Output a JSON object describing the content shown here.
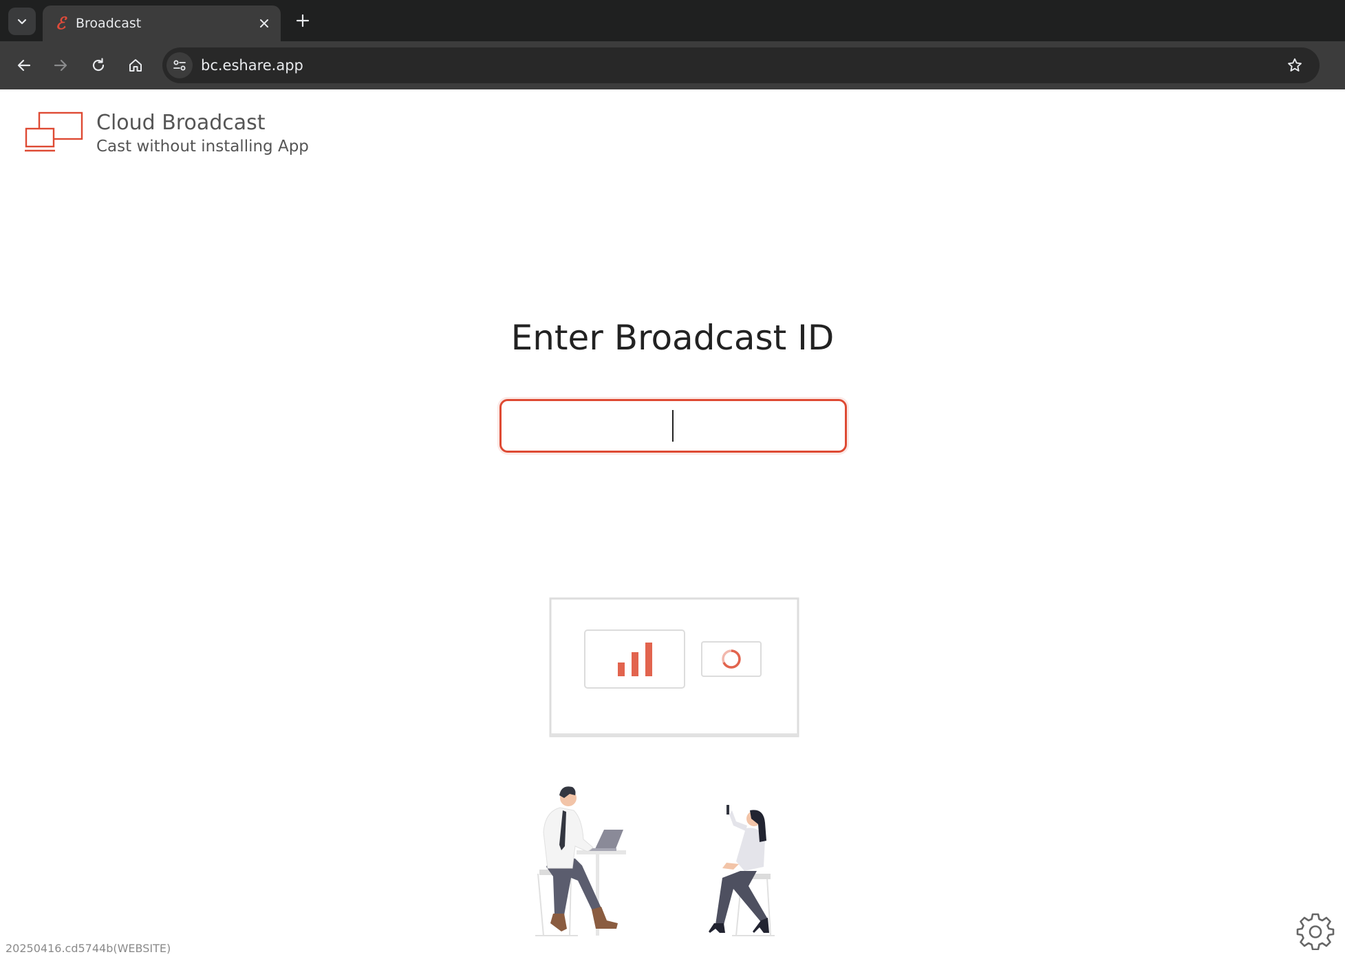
{
  "browser": {
    "tab_title": "Broadcast",
    "favicon_glyph": "ℰ",
    "url": "bc.eshare.app",
    "icons": [
      "chevron-down-icon",
      "close-icon",
      "plus-icon",
      "back-arrow-icon",
      "forward-arrow-icon",
      "reload-icon",
      "home-icon",
      "site-info-icon",
      "star-icon"
    ]
  },
  "brand": {
    "title": "Cloud Broadcast",
    "subtitle": "Cast without installing App",
    "accent": "#de4a33"
  },
  "main": {
    "heading": "Enter Broadcast ID",
    "id_input": {
      "value": "",
      "placeholder": ""
    }
  },
  "footer": {
    "version": "20250416.cd5744b(WEBSITE)",
    "settings_icon": "gear-icon"
  }
}
